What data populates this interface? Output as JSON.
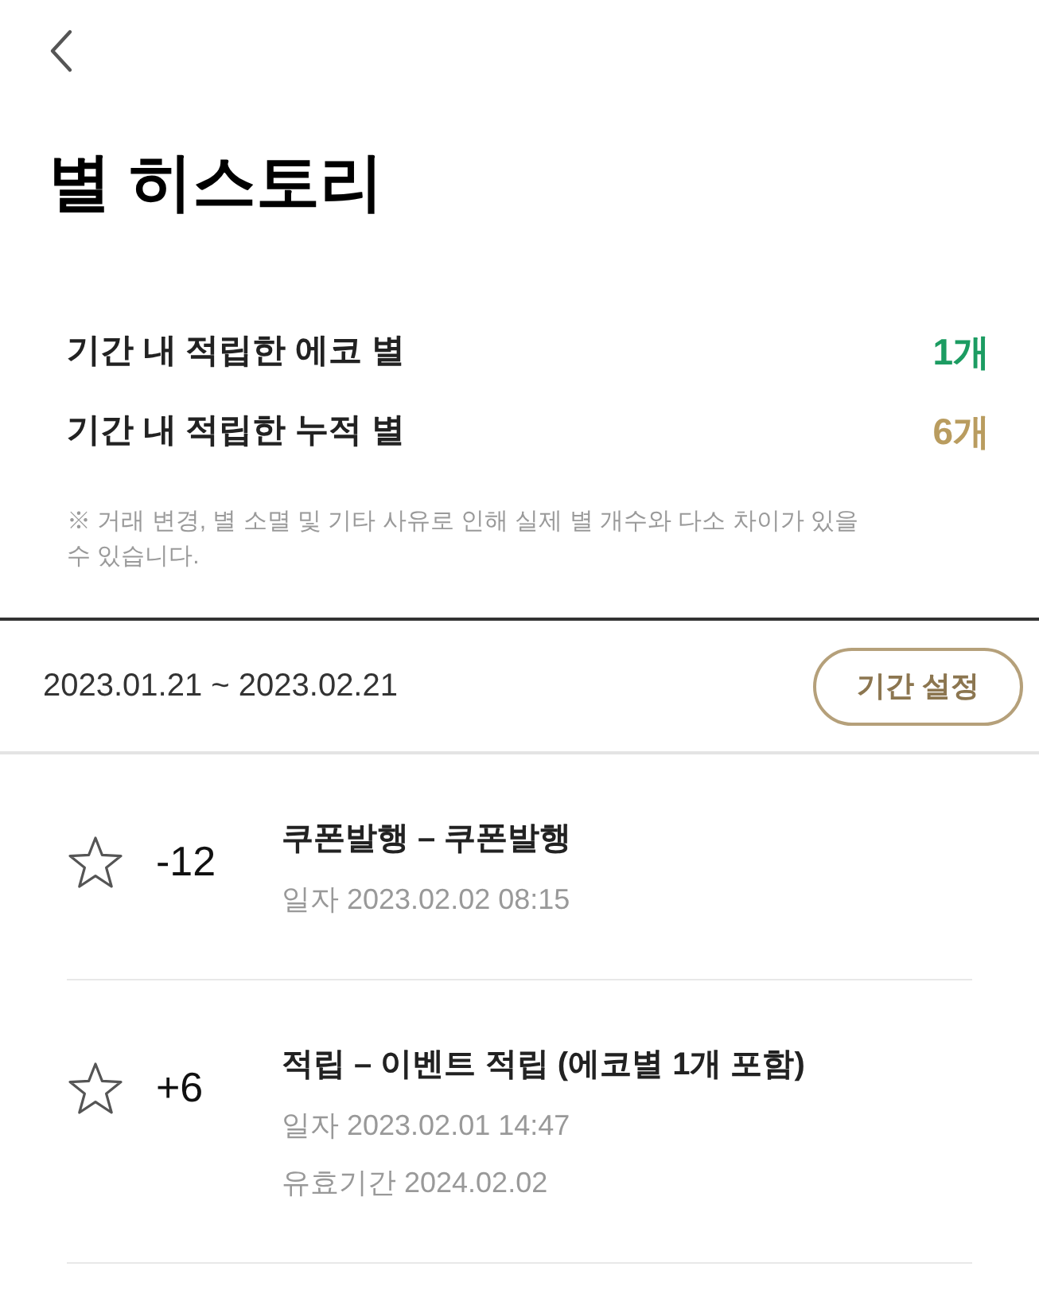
{
  "header": {
    "title": "별 히스토리"
  },
  "summary": [
    {
      "label": "기간 내 적립한 에코 별",
      "value": "1개",
      "color": "#1c9c62"
    },
    {
      "label": "기간 내 적립한 누적 별",
      "value": "6개",
      "color": "#b99c5f"
    }
  ],
  "note": "※ 거래 변경, 별 소멸 및 기타 사유로 인해 실제 별 개수와 다소 차이가 있을 수 있습니다.",
  "period": {
    "range": "2023.01.21 ~ 2023.02.21",
    "button": "기간 설정"
  },
  "history": [
    {
      "amount": "-12",
      "title": "쿠폰발행 – 쿠폰발행",
      "details": [
        "일자 2023.02.02 08:15"
      ]
    },
    {
      "amount": "+6",
      "title": "적립 – 이벤트 적립 (에코별 1개 포함)",
      "details": [
        "일자 2023.02.01 14:47",
        "유효기간 2024.02.02"
      ]
    }
  ]
}
